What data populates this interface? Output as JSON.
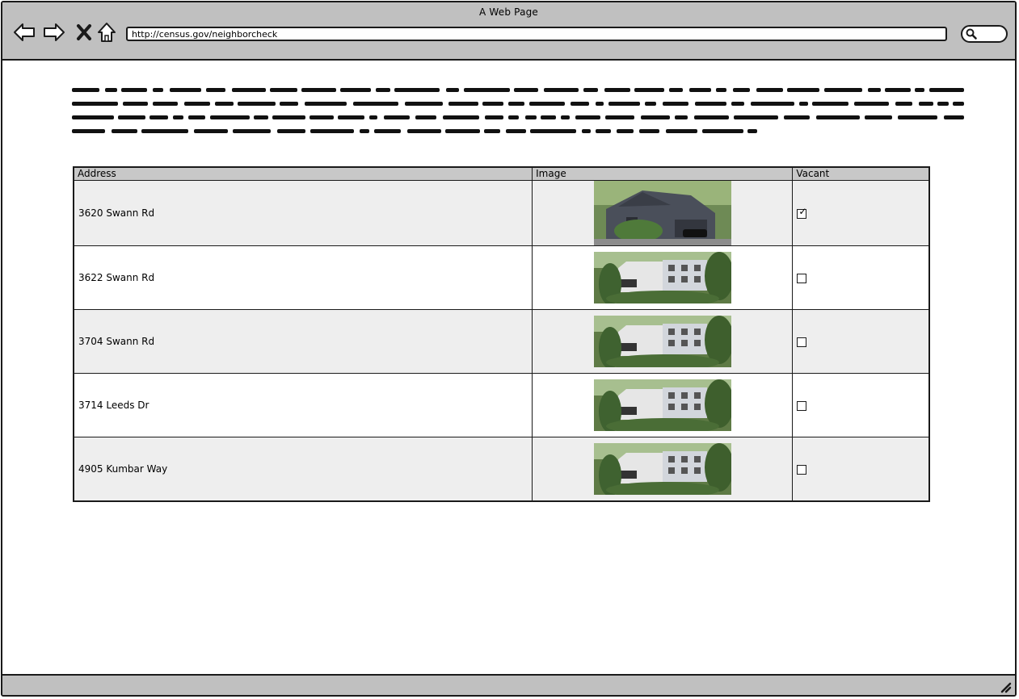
{
  "window": {
    "title": "A Web Page"
  },
  "toolbar": {
    "back_icon": "back-arrow-icon",
    "forward_icon": "forward-arrow-icon",
    "stop_icon": "close-icon",
    "home_icon": "home-icon",
    "url": "http://census.gov/neighborcheck",
    "search_icon": "search-icon"
  },
  "table": {
    "headers": {
      "address": "Address",
      "image": "Image",
      "vacant": "Vacant"
    },
    "rows": [
      {
        "address": "3620 Swann Rd",
        "vacant": true,
        "image": "house-photo"
      },
      {
        "address": "3622 Swann Rd",
        "vacant": false,
        "image": "house-photo"
      },
      {
        "address": "3704 Swann Rd",
        "vacant": false,
        "image": "house-photo"
      },
      {
        "address": "3714 Leeds Dr",
        "vacant": false,
        "image": "house-photo"
      },
      {
        "address": "4905 Kumbar Way",
        "vacant": false,
        "image": "house-photo"
      }
    ]
  }
}
